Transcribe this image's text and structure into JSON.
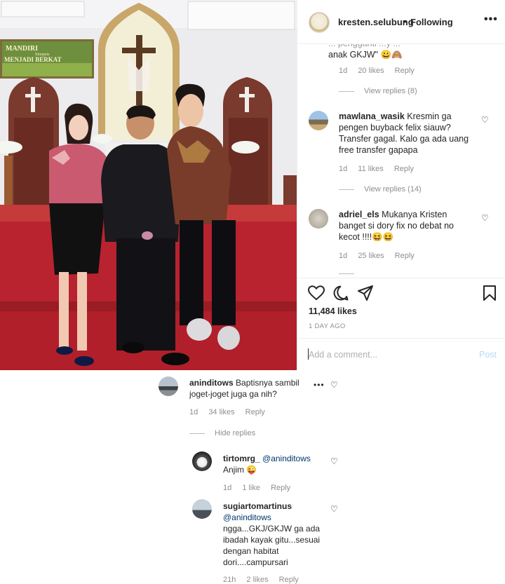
{
  "header": {
    "username": "kresten.selubung",
    "separator": "•",
    "follow_status": "Following",
    "more_icon": "•••"
  },
  "panel_comments": {
    "c0": {
      "text_tail_1": "... pengganti ...y ...",
      "text_tail_2": "anak GKJW\" 😀🙈",
      "time": "1d",
      "likes": "20 likes",
      "reply": "Reply",
      "view_replies": "View replies (8)"
    },
    "c1": {
      "username": "mawlana_wasik",
      "text_1": "Kresmin ga",
      "text_2": "pengen buyback felix siauw?",
      "text_3": "Transfer gagal. Kalo ga ada uang",
      "text_4": "free transfer gapapa",
      "time": "1d",
      "likes": "11 likes",
      "reply": "Reply",
      "view_replies": "View replies (14)"
    },
    "c2": {
      "username": "adriel_els",
      "text_1": "Mukanya Kristen",
      "text_2": "banget si dory fix no debat no",
      "text_3": "kecot !!!!😆😆",
      "time": "1d",
      "likes": "25 likes",
      "reply": "Reply"
    }
  },
  "actions": {
    "likes": "11,484 likes",
    "posted": "1 DAY AGO",
    "add_comment_placeholder": "Add a comment...",
    "post_label": "Post"
  },
  "lower_comments": {
    "c1": {
      "username": "aninditows",
      "text_1": "Baptisnya sambil",
      "text_2": "joget-joget juga ga nih?",
      "more": "•••",
      "time": "1d",
      "likes": "34 likes",
      "reply": "Reply",
      "hide_replies": "Hide replies"
    },
    "r1": {
      "username": "tirtomrg_",
      "mention": "@aninditows",
      "text": "Anjim 😜",
      "time": "1d",
      "likes": "1 like",
      "reply": "Reply"
    },
    "r2": {
      "username": "sugiartomartinus",
      "mention": "@aninditows",
      "text_1": "ngga...GKJ/GKJW ga ada",
      "text_2": "ibadah kayak gitu...sesuai",
      "text_3": "dengan habitat",
      "text_4": "dori....campursari",
      "time": "21h",
      "likes": "2 likes",
      "reply": "Reply"
    }
  },
  "photo": {
    "banner_line_1": "MANDIRI",
    "banner_line_2": "Sinopsis",
    "banner_line_3": "MENJADI BERKAT"
  },
  "icons": {
    "heart": "heart-icon",
    "comment": "comment-icon",
    "share": "share-icon",
    "save": "bookmark-icon"
  },
  "colors": {
    "carpet": "#b8232f",
    "wall": "#ecebed",
    "link_blue": "#b3dbff",
    "muted": "#8e8e8e"
  }
}
